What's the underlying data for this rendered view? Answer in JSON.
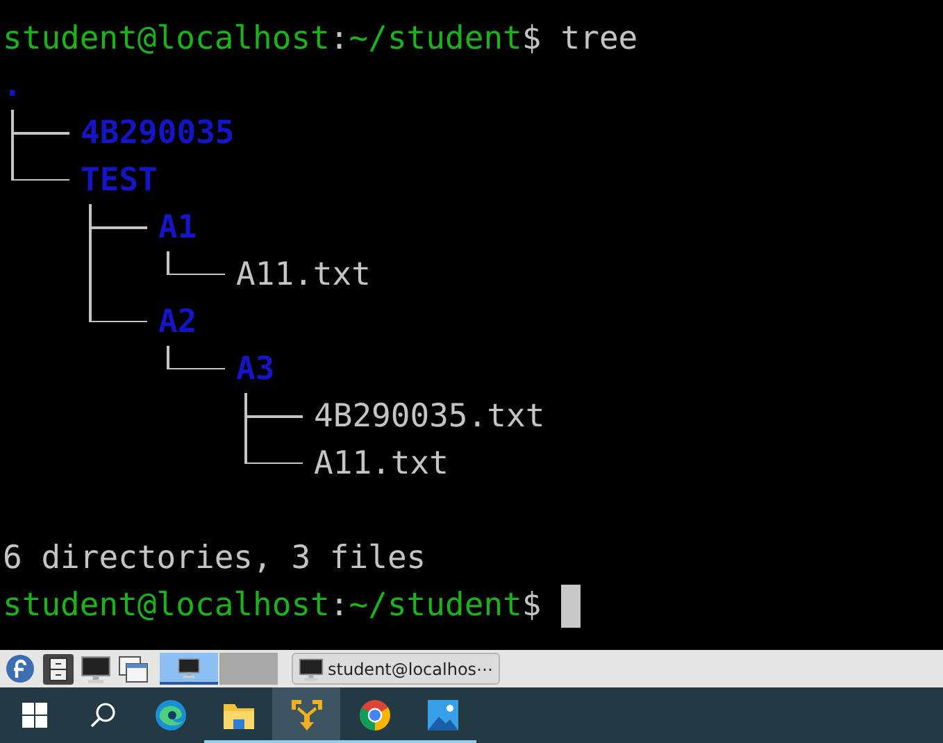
{
  "terminal": {
    "command_prompt": {
      "user_host": "student@localhost",
      "colon": ":",
      "path": "~/student",
      "dollar": "$",
      "command": "tree"
    },
    "tree": {
      "label": ".",
      "kind": "dir",
      "children": [
        {
          "label": "4B290035",
          "kind": "dir"
        },
        {
          "label": "TEST",
          "kind": "dir",
          "children": [
            {
              "label": "A1",
              "kind": "dir",
              "children": [
                {
                  "label": "A11.txt",
                  "kind": "file"
                }
              ]
            },
            {
              "label": "A2",
              "kind": "dir",
              "children": [
                {
                  "label": "A3",
                  "kind": "dir",
                  "children": [
                    {
                      "label": "4B290035.txt",
                      "kind": "file"
                    },
                    {
                      "label": "A11.txt",
                      "kind": "file"
                    }
                  ]
                }
              ]
            }
          ]
        }
      ]
    },
    "summary": "6 directories, 3 files",
    "final_prompt": {
      "user_host": "student@localhost",
      "colon": ":",
      "path": "~/student",
      "dollar": "$"
    }
  },
  "panel": {
    "launchers": [
      {
        "kind": "fedora"
      },
      {
        "kind": "cabinet"
      },
      {
        "kind": "monitor"
      },
      {
        "kind": "windows"
      }
    ],
    "desktops": [
      {
        "selected": true
      },
      {
        "selected": false
      }
    ],
    "task": {
      "label": "student@localhos⋯"
    }
  },
  "taskbar": {
    "apps": [
      {
        "kind": "start",
        "active": false,
        "running": false
      },
      {
        "kind": "search",
        "active": false,
        "running": false
      },
      {
        "kind": "edge",
        "active": false,
        "running": false
      },
      {
        "kind": "folder",
        "active": false,
        "running": true
      },
      {
        "kind": "vm",
        "active": true,
        "running": true
      },
      {
        "kind": "chrome",
        "active": false,
        "running": true
      },
      {
        "kind": "photos",
        "active": false,
        "running": true
      }
    ]
  }
}
